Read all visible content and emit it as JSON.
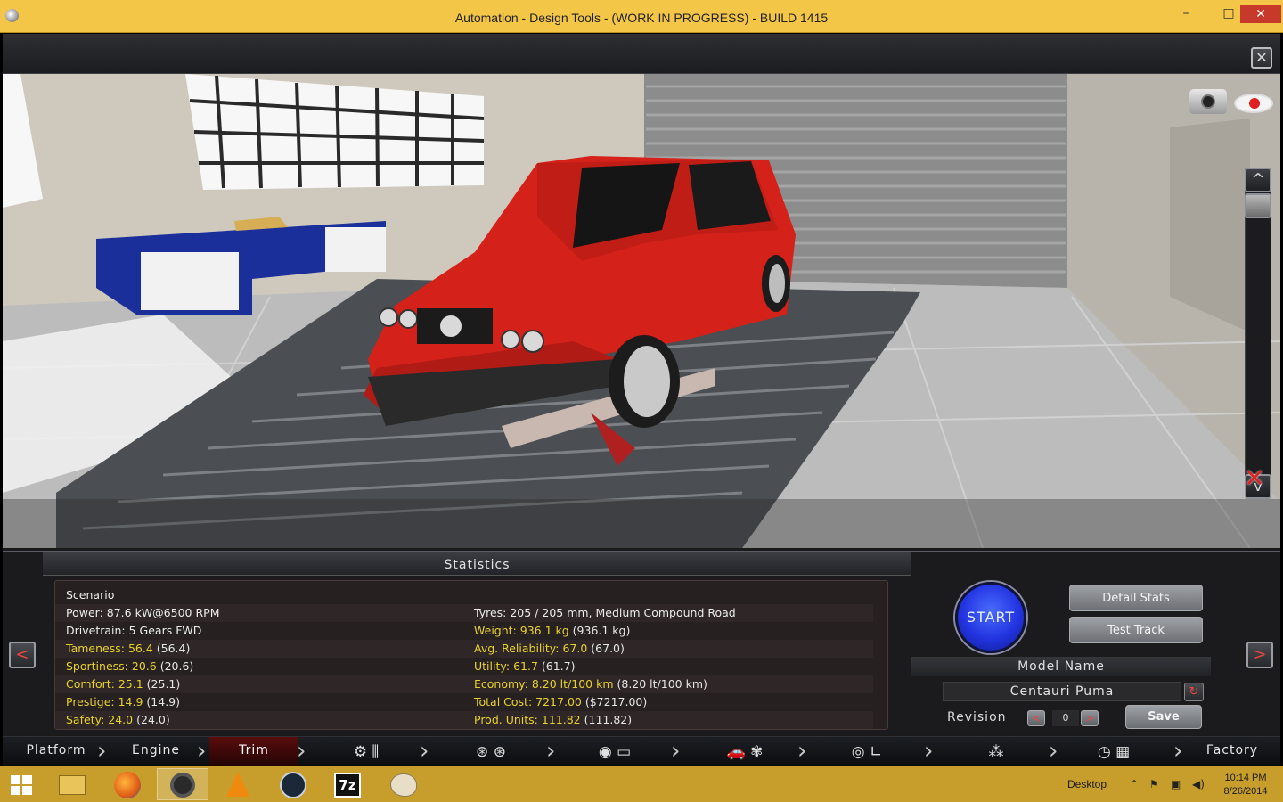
{
  "window": {
    "title": "Automation - Design Tools - (WORK IN PROGRESS) - BUILD 1415",
    "minimize_glyph": "–",
    "maximize_glyph": "□",
    "close_glyph": "✕"
  },
  "game": {
    "close_glyph": "✕",
    "camera_controls": {
      "up_glyph": "^",
      "down_glyph": "v"
    }
  },
  "statistics": {
    "header": "Statistics",
    "left_column": [
      {
        "label": "Scenario",
        "value": "",
        "raw": "",
        "highlight": false
      },
      {
        "label": "Power:",
        "value": "87.6 kW@6500 RPM",
        "raw": "",
        "highlight": false
      },
      {
        "label": "Drivetrain:",
        "value": "5 Gears FWD",
        "raw": "",
        "highlight": false
      },
      {
        "label": "Tameness:",
        "value": "56.4",
        "raw": "(56.4)",
        "highlight": true
      },
      {
        "label": "Sportiness:",
        "value": "20.6",
        "raw": "(20.6)",
        "highlight": true
      },
      {
        "label": "Comfort:",
        "value": "25.1",
        "raw": "(25.1)",
        "highlight": true
      },
      {
        "label": "Prestige:",
        "value": "14.9",
        "raw": "(14.9)",
        "highlight": true
      },
      {
        "label": "Safety:",
        "value": "24.0",
        "raw": "(24.0)",
        "highlight": true
      }
    ],
    "right_column": [
      {
        "label": "",
        "value": "",
        "raw": "",
        "highlight": false
      },
      {
        "label": "Tyres:",
        "value": "205 / 205 mm, Medium Compound Road",
        "raw": "",
        "highlight": false
      },
      {
        "label": "Weight:",
        "value": "936.1 kg",
        "raw": "(936.1 kg)",
        "highlight": true
      },
      {
        "label": "Avg. Reliability:",
        "value": "67.0",
        "raw": "(67.0)",
        "highlight": true
      },
      {
        "label": "Utility:",
        "value": "61.7",
        "raw": "(61.7)",
        "highlight": true
      },
      {
        "label": "Economy:",
        "value": "8.20 lt/100 km",
        "raw": "(8.20 lt/100 km)",
        "highlight": true
      },
      {
        "label": "Total Cost:",
        "value": "7217.00",
        "raw": "($7217.00)",
        "highlight": true
      },
      {
        "label": "Prod. Units:",
        "value": "111.82",
        "raw": "(111.82)",
        "highlight": true
      }
    ],
    "prev_glyph": "<",
    "next_glyph": ">"
  },
  "controls": {
    "start_label": "START",
    "detail_stats_label": "Detail Stats",
    "test_track_label": "Test Track",
    "model_name_header": "Model Name",
    "model_name_value": "Centauri Puma",
    "refresh_glyph": "↻",
    "revision_label": "Revision",
    "revision_value": "0",
    "rev_prev_glyph": "<",
    "rev_next_glyph": ">",
    "save_label": "Save"
  },
  "nav": {
    "tabs": [
      "Platform",
      "Engine",
      "Trim",
      "Factory"
    ],
    "active_tab": "Trim",
    "icon_glyphs": [
      "⚙ ⫼",
      "⊛ ⊛",
      "◉ ▭",
      "🚗 ✾",
      "◎ ∟",
      "⁂",
      "◷ ▦"
    ]
  },
  "taskbar": {
    "desktop_label": "Desktop",
    "time": "10:14 PM",
    "date": "8/26/2014",
    "sevenzip_label": "7z"
  },
  "colors": {
    "title_bar": "#f3c648",
    "taskbar": "#c79e2c",
    "highlight_text": "#e9d22c",
    "start_button": "#2234e0",
    "car_body": "#d4211a"
  }
}
